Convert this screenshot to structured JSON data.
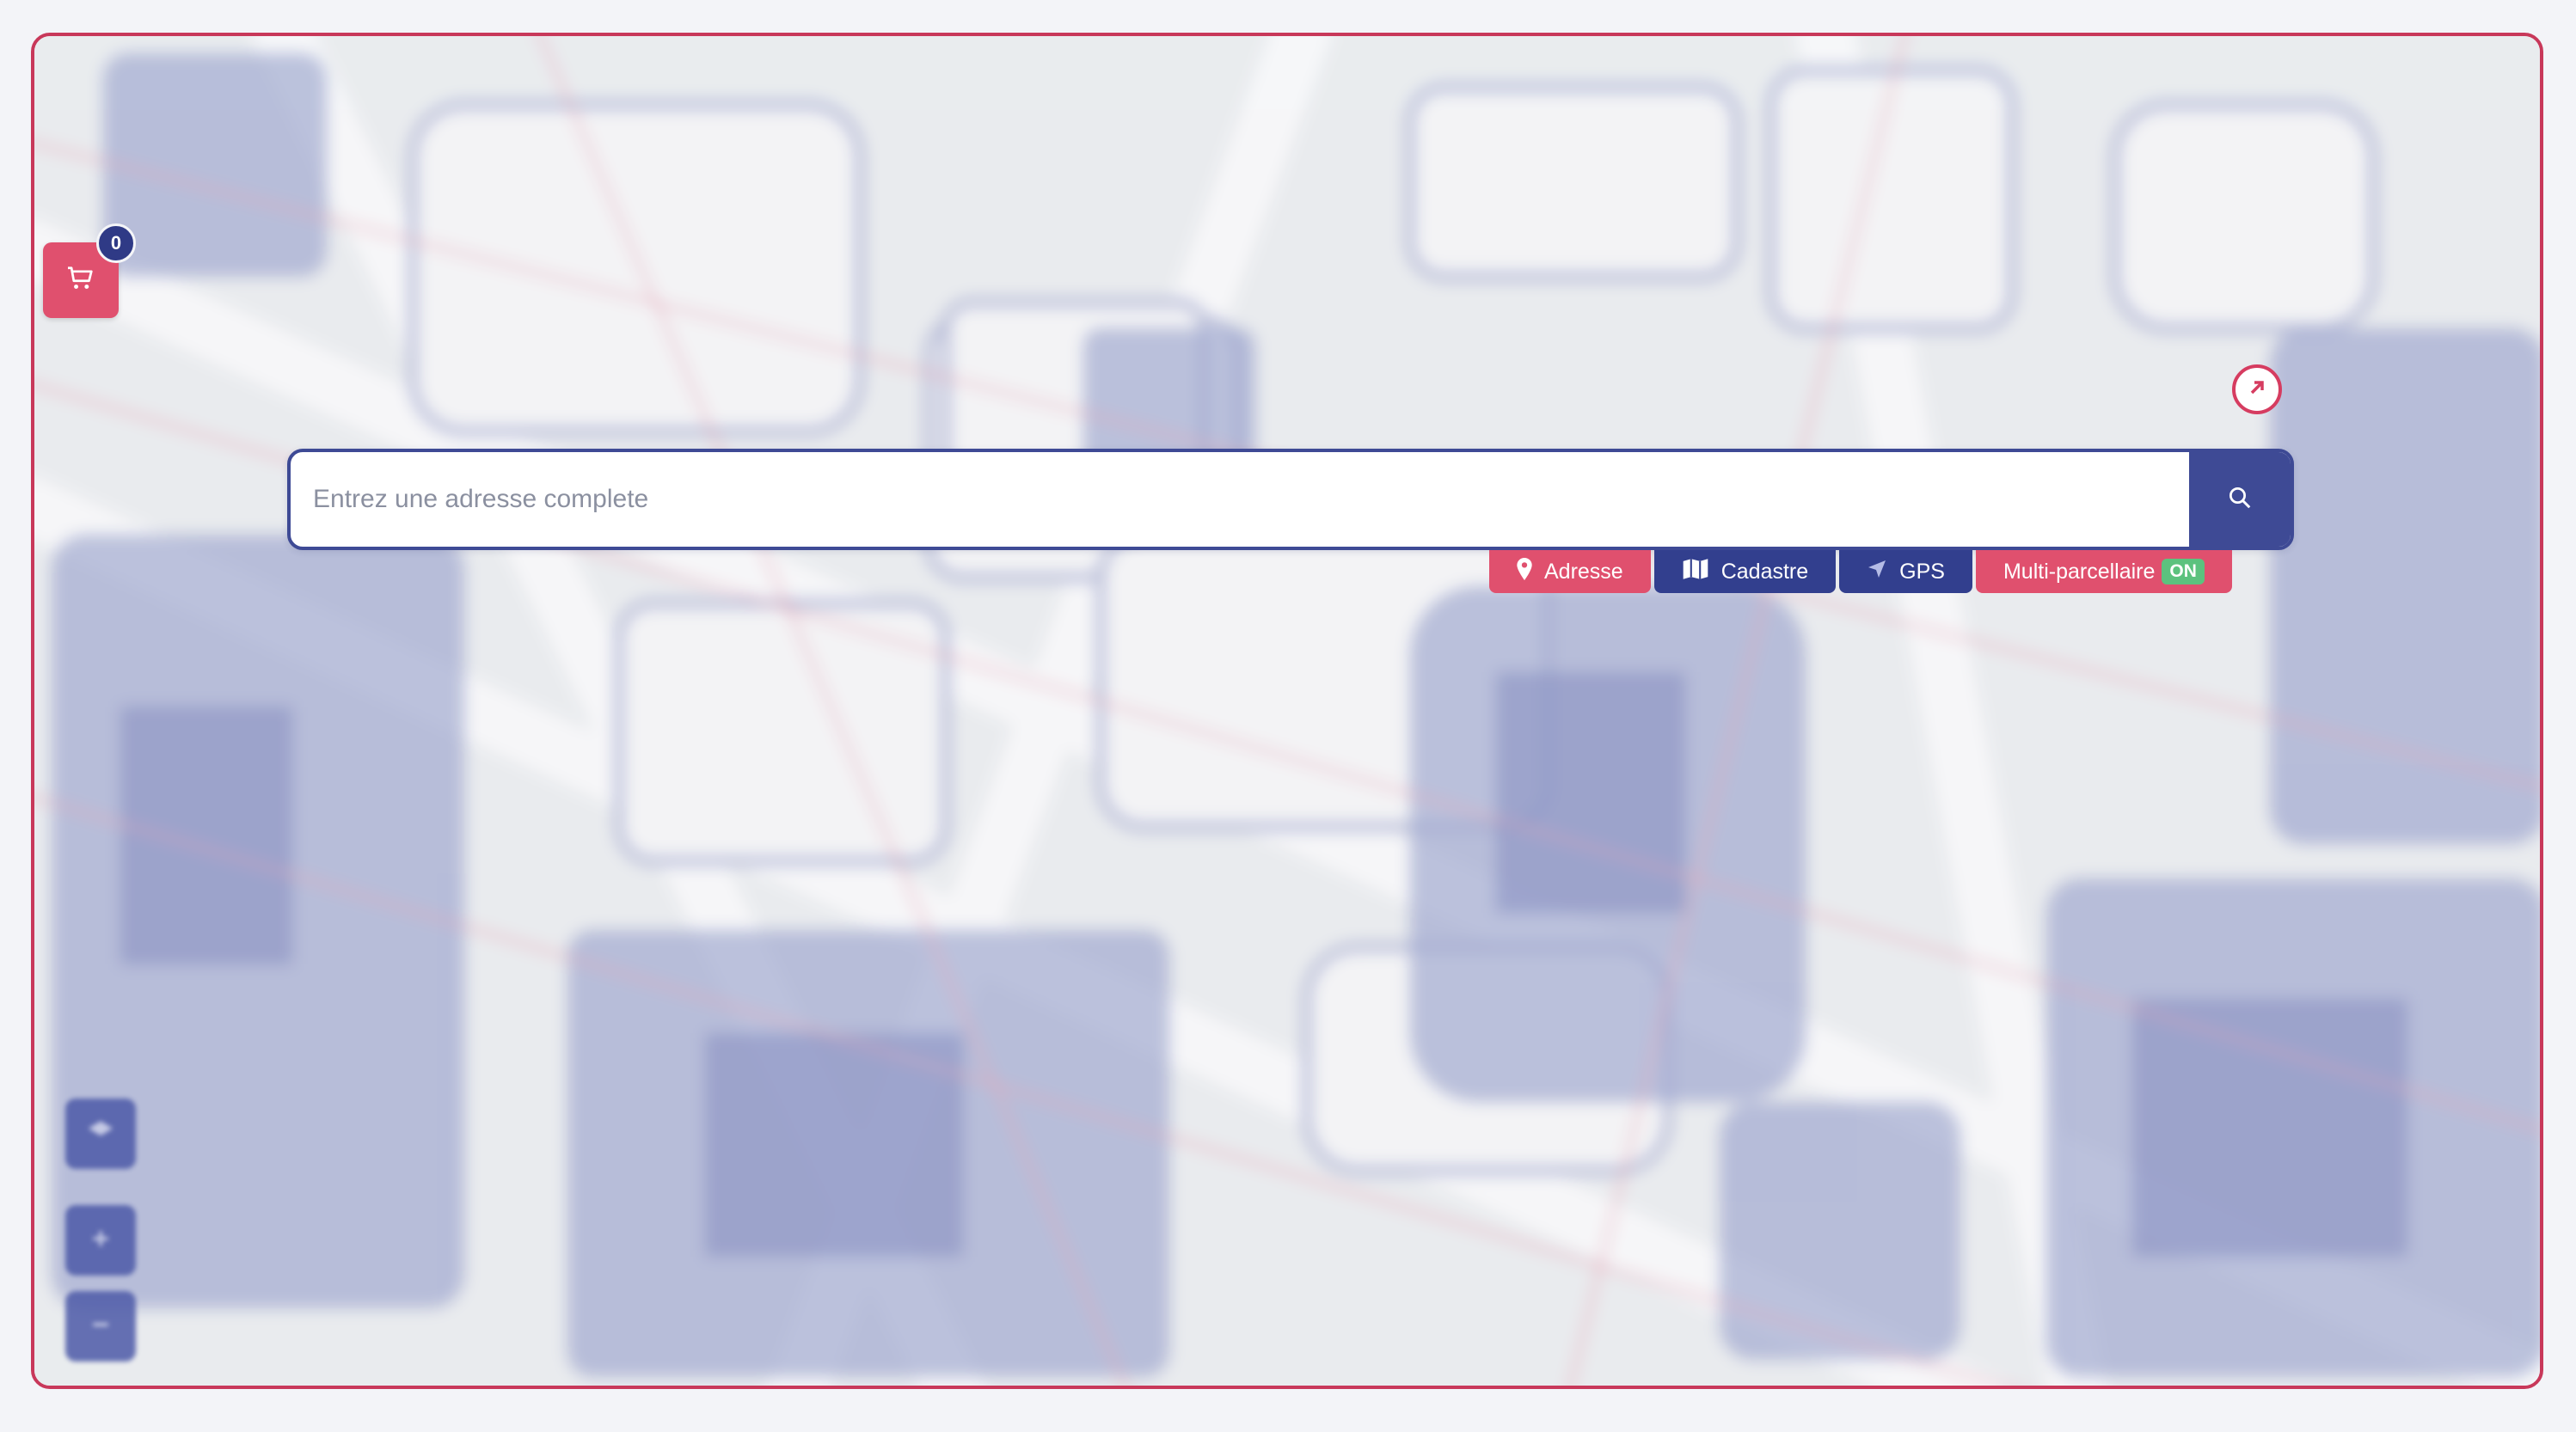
{
  "cart": {
    "count": "0",
    "icon": "cart-icon"
  },
  "search": {
    "placeholder": "Entrez une adresse complete",
    "value": "",
    "button_icon": "search-icon",
    "expand_icon": "expand-arrow-icon"
  },
  "modes": [
    {
      "label": "Adresse",
      "icon": "map-pin-icon",
      "color": "#e0506e"
    },
    {
      "label": "Cadastre",
      "icon": "map-icon",
      "color": "#323f8e"
    },
    {
      "label": "GPS",
      "icon": "navigation-arrow-icon",
      "color": "#323f8e"
    },
    {
      "label": "Multi-parcellaire",
      "badge": "ON",
      "color": "#e0506e"
    }
  ],
  "map_controls": [
    {
      "icon": "layers-icon"
    },
    {
      "icon": "zoom-in-icon"
    },
    {
      "icon": "zoom-out-icon"
    }
  ],
  "colors": {
    "accent_pink": "#e0506e",
    "accent_blue": "#323f8e",
    "frame_border": "#c8385a",
    "on_badge": "#5cc27e"
  }
}
